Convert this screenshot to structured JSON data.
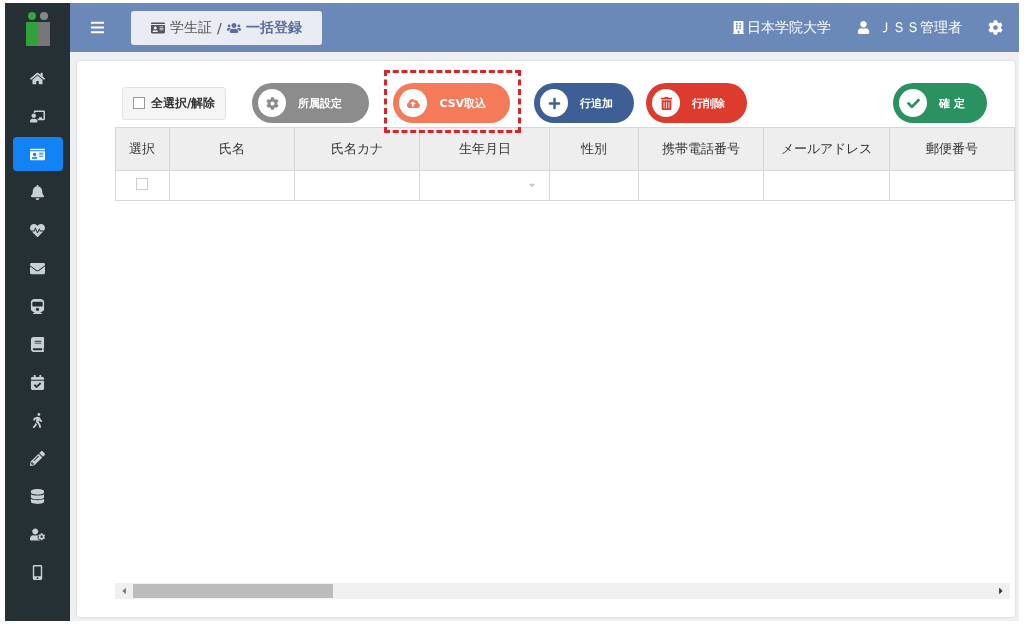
{
  "sidebar": {
    "items": [
      {
        "selected": false
      },
      {
        "selected": false
      },
      {
        "selected": true
      },
      {
        "selected": false
      },
      {
        "selected": false
      },
      {
        "selected": false
      },
      {
        "selected": false
      },
      {
        "selected": false
      },
      {
        "selected": false
      },
      {
        "selected": false
      },
      {
        "selected": false
      },
      {
        "selected": false
      },
      {
        "selected": false
      },
      {
        "selected": false
      }
    ]
  },
  "breadcrumb": [
    {
      "label": "学生証"
    },
    {
      "label": "/"
    },
    {
      "label": "一括登録"
    }
  ],
  "header": {
    "organization": "日本学院大学",
    "user": "ＪＳＳ管理者"
  },
  "toolbar": {
    "select_all": {
      "label": "全選択/解除",
      "checked": false
    },
    "buttons": [
      {
        "kind": "settings",
        "label": "所属設定",
        "highlighted": false
      },
      {
        "kind": "upload",
        "label": "CSV取込",
        "highlighted": true
      },
      {
        "kind": "add",
        "label": "行追加",
        "highlighted": false
      },
      {
        "kind": "delete",
        "label": "行削除",
        "highlighted": false
      },
      {
        "kind": "confirm",
        "label": "確 定",
        "highlighted": false
      }
    ]
  },
  "table": {
    "columns": [
      "選択",
      "氏名",
      "氏名カナ",
      "生年月日",
      "性別",
      "携帯電話番号",
      "メールアドレス",
      "郵便番号"
    ],
    "rows": [
      {
        "checked": false
      }
    ]
  }
}
